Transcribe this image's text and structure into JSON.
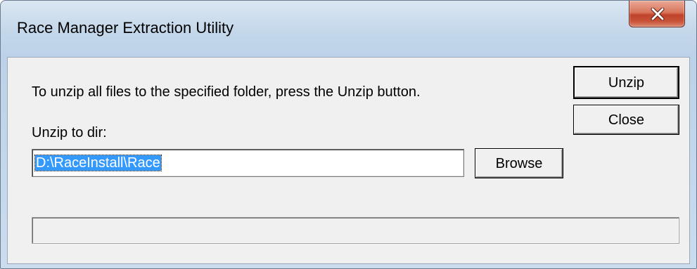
{
  "window": {
    "title": "Race Manager Extraction Utility"
  },
  "dialog": {
    "instruction": "To unzip all files to the specified folder, press the Unzip button.",
    "dir_label": "Unzip to dir:",
    "dir_value": "D:\\RaceInstall\\Race",
    "unzip_label": "Unzip",
    "close_label": "Close",
    "browse_label": "Browse",
    "progress": 0
  },
  "icons": {
    "close": "close-icon"
  },
  "colors": {
    "selection": "#3399ff",
    "close_button": "#c8543a",
    "dialog_face": "#f0f0f0"
  }
}
